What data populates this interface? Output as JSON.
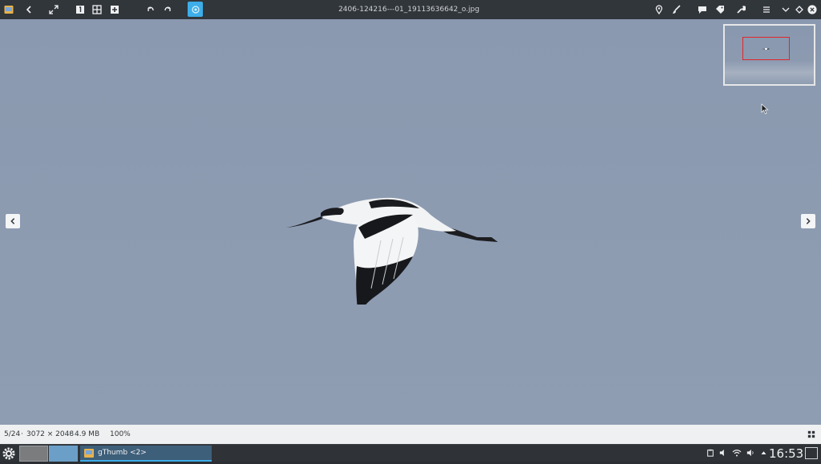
{
  "window": {
    "title": "2406-124216---01_19113636642_o.jpg"
  },
  "statusbar": {
    "position": "5/24",
    "dimensions": "3072 × 2048",
    "filesize": "4.9 MB",
    "zoom": "100%",
    "separator": "·"
  },
  "taskbar": {
    "task_label": "gThumb <2>",
    "clock": "16:53"
  },
  "colors": {
    "accent": "#3daee9",
    "toolbar_bg": "#31363b",
    "viewer_bg": "#8c9ab0",
    "overview_frame": "#e0262c"
  },
  "icons": {
    "app": "gthumb-app-icon",
    "back": "chevron-left-icon",
    "fullscreen": "fullscreen-icon",
    "zoom_actual": "zoom-100-icon",
    "zoom_fit": "zoom-fit-icon",
    "zoom_in": "zoom-in-icon",
    "rotate_left": "rotate-left-icon",
    "rotate_right": "rotate-right-icon",
    "edit": "edit-icon",
    "location": "location-pin-icon",
    "brush": "brush-icon",
    "comment": "comment-icon",
    "tag": "tag-icon",
    "tools": "wrench-icon",
    "menu": "hamburger-menu-icon",
    "minimize": "chevron-down-icon",
    "maximize": "diamond-icon",
    "close": "close-icon"
  }
}
